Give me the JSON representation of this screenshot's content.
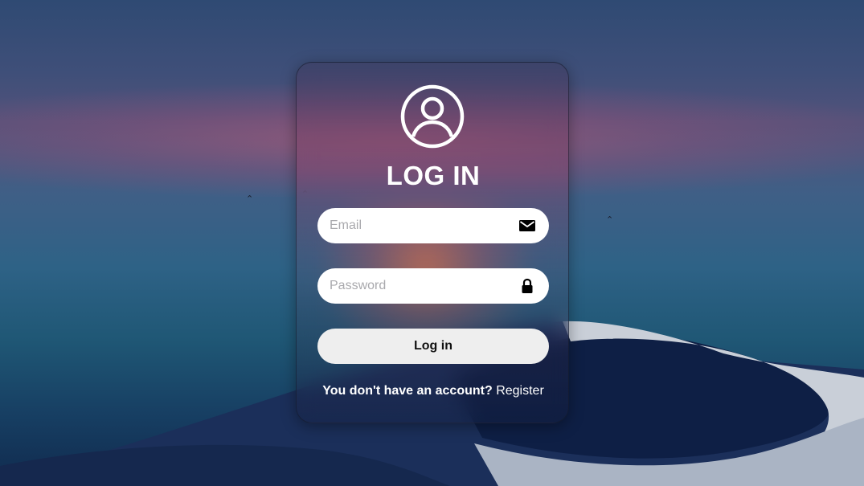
{
  "form": {
    "title": "LOG IN",
    "email": {
      "placeholder": "Email",
      "value": ""
    },
    "password": {
      "placeholder": "Password",
      "value": ""
    },
    "submit_label": "Log in",
    "footer_text": "You don't have an account?",
    "register_link": "Register"
  },
  "icons": {
    "avatar": "user-circle-icon",
    "email": "envelope-icon",
    "password": "lock-icon"
  },
  "colors": {
    "card_text": "#ffffff",
    "input_bg": "#ffffff",
    "button_bg": "#eeeeee",
    "placeholder": "#a9a9ad"
  }
}
